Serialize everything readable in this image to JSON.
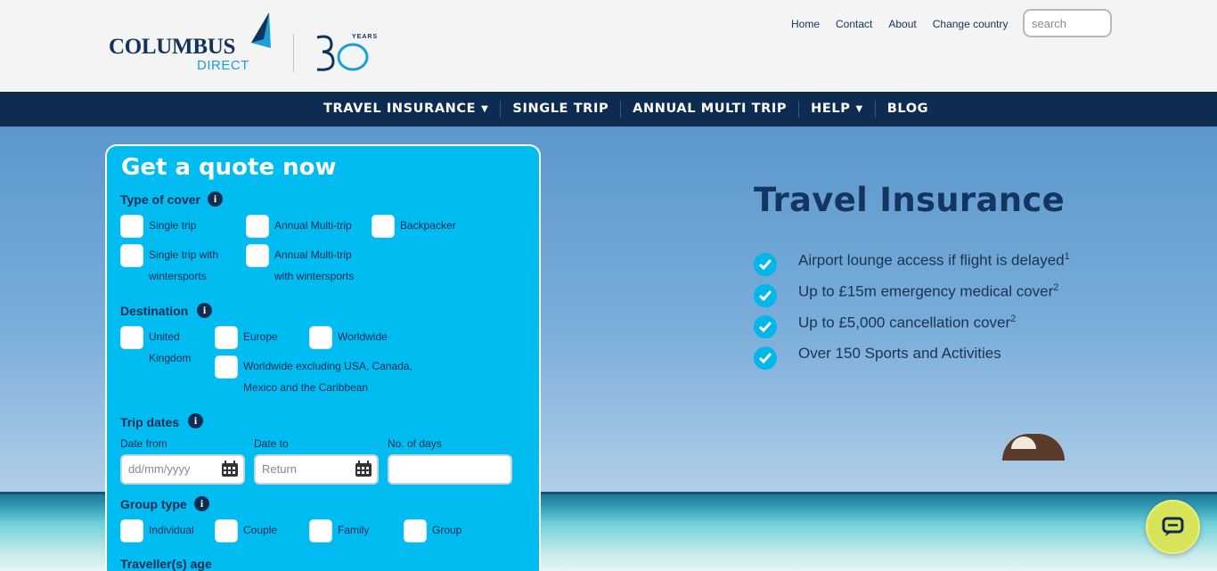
{
  "brand": {
    "name": "COLUMBUS",
    "sub": "DIRECT",
    "years_label": "YEARS"
  },
  "top_links": [
    "Home",
    "Contact",
    "About",
    "Change country"
  ],
  "search": {
    "placeholder": "search"
  },
  "nav": [
    {
      "label": "TRAVEL INSURANCE",
      "dropdown": true
    },
    {
      "label": "SINGLE TRIP",
      "dropdown": false
    },
    {
      "label": "ANNUAL MULTI TRIP",
      "dropdown": false
    },
    {
      "label": "HELP",
      "dropdown": true
    },
    {
      "label": "BLOG",
      "dropdown": false
    }
  ],
  "quote": {
    "title": "Get a quote now",
    "cover_label": "Type of cover",
    "cover_options": [
      "Single trip",
      "Annual Multi-trip",
      "Backpacker",
      "Single trip with wintersports",
      "Annual Multi-trip with wintersports"
    ],
    "destination_label": "Destination",
    "destination_options": [
      "United Kingdom",
      "Europe",
      "Worldwide",
      "Worldwide excluding USA, Canada, Mexico and the Caribbean"
    ],
    "dates_label": "Trip dates",
    "date_from_label": "Date from",
    "date_to_label": "Date to",
    "days_label": "No. of days",
    "date_from_placeholder": "dd/mm/yyyy",
    "date_to_placeholder": "Return",
    "days_value": "",
    "group_label": "Group type",
    "group_options": [
      "Individual",
      "Couple",
      "Family",
      "Group"
    ],
    "age_label": "Traveller(s) age"
  },
  "hero": {
    "title": "Travel Insurance",
    "bullets": [
      {
        "text": "Airport lounge access if flight is delayed",
        "sup": "1"
      },
      {
        "text": "Up to £15m emergency medical cover",
        "sup": "2"
      },
      {
        "text": "Up to £5,000 cancellation cover",
        "sup": "2"
      },
      {
        "text": "Over 150 Sports and Activities",
        "sup": ""
      }
    ]
  },
  "colors": {
    "navy": "#0e2c52",
    "form_blue": "#00bcf0",
    "accent": "#00b6ea",
    "chat": "#d8e359"
  },
  "icons": {
    "info": "info-icon",
    "calendar": "calendar-icon",
    "check": "check-icon",
    "chat": "chat-icon"
  }
}
